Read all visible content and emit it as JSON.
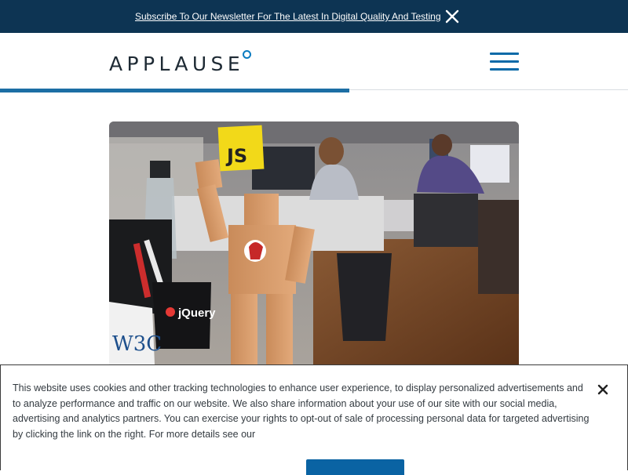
{
  "top_banner": {
    "text": "Subscribe To Our Newsletter For The Latest In Digital Quality And Testing",
    "close_icon": "close-icon",
    "background": "#0d3453"
  },
  "header": {
    "logo_text": "APPLAUSE",
    "menu_icon": "hamburger-menu-icon",
    "accent": "#0a6aa8"
  },
  "hero": {
    "sticky_note_text": "JS",
    "mug_text": "jQuery",
    "w3c_text": "W3C"
  },
  "cookie_banner": {
    "text": "This website uses cookies and other tracking technologies to enhance user experience, to display personalized advertisements and to analyze performance and traffic on our website. We also share information about your use of our site with our social media, advertising and analytics partners. You can exercise your rights to opt-out of sale of processing personal data for targeted advertising by clicking the link on the right. For more details see our",
    "close_icon": "close-icon",
    "button_label": ""
  }
}
